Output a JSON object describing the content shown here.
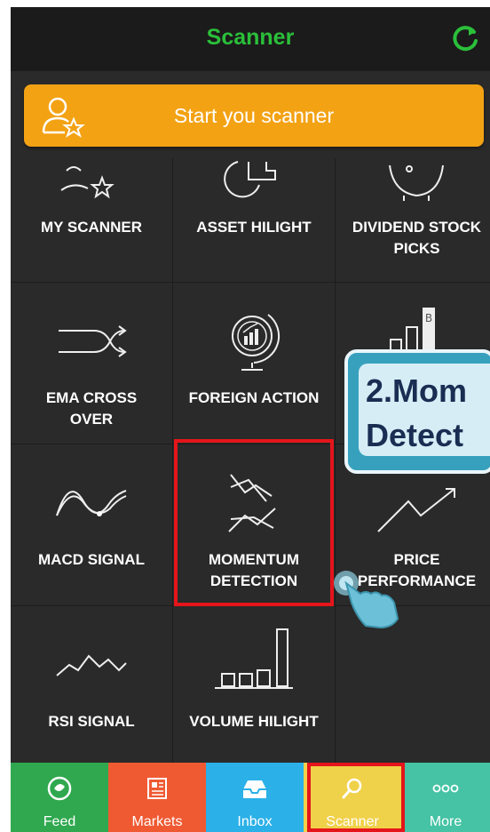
{
  "header": {
    "title": "Scanner"
  },
  "start_button": {
    "label": "Start you scanner"
  },
  "tiles": [
    {
      "line1": "MY SCANNER",
      "line2": ""
    },
    {
      "line1": "ASSET HILIGHT",
      "line2": ""
    },
    {
      "line1": "DIVIDEND STOCK",
      "line2": "PICKS"
    },
    {
      "line1": "EMA CROSS",
      "line2": "OVER"
    },
    {
      "line1": "FOREIGN ACTION",
      "line2": ""
    },
    {
      "line1": "MACD SIGNAL",
      "line2": ""
    },
    {
      "line1": "MOMENTUM",
      "line2": "DETECTION"
    },
    {
      "line1": "PRICE",
      "line2": "PERFORMANCE"
    },
    {
      "line1": "RSI SIGNAL",
      "line2": ""
    },
    {
      "line1": "VOLUME HILIGHT",
      "line2": ""
    }
  ],
  "callout": {
    "line1": "2.Mom",
    "line2": "Detect"
  },
  "nav": [
    {
      "label": "Feed",
      "color": "#2fa84f"
    },
    {
      "label": "Markets",
      "color": "#ef5a32"
    },
    {
      "label": "Inbox",
      "color": "#2bb0e8"
    },
    {
      "label": "Scanner",
      "color": "#f0d14a"
    },
    {
      "label": "More",
      "color": "#45c3a4"
    }
  ],
  "colors": {
    "accent_green": "#2bbf3a",
    "start_orange": "#f3a214",
    "highlight_red": "#e4151b"
  }
}
